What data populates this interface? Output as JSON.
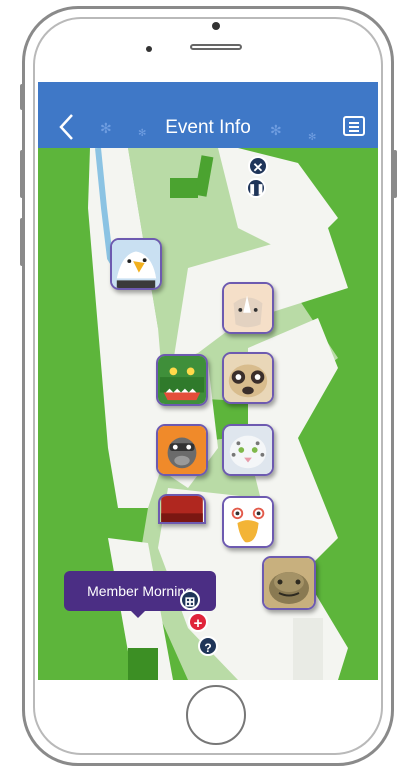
{
  "header": {
    "title": "Event Info",
    "back_icon": "chevron-left-icon",
    "menu_icon": "list-menu-icon",
    "background": "#3f78c7"
  },
  "map": {
    "grass_color": "#5db53b",
    "path_color": "#f4f5f1",
    "pale_area_color": "#b9dba6",
    "tooltip": {
      "text": "Member Morning",
      "color": "#4b2e84"
    },
    "exhibits": [
      {
        "name": "bald-eagle"
      },
      {
        "name": "rhino"
      },
      {
        "name": "crocodile"
      },
      {
        "name": "meerkat"
      },
      {
        "name": "orangutan"
      },
      {
        "name": "snow-leopard"
      },
      {
        "name": "red-panda"
      },
      {
        "name": "bird"
      },
      {
        "name": "tortoise"
      }
    ],
    "pins": [
      {
        "icon": "close-icon",
        "color": "#1f3559"
      },
      {
        "icon": "pause-icon",
        "color": "#1f3559"
      },
      {
        "icon": "grid-icon",
        "color": "#1f3559"
      },
      {
        "icon": "first-aid-icon",
        "color": "#e0243a"
      },
      {
        "icon": "help-icon",
        "color": "#1f3559"
      }
    ]
  }
}
